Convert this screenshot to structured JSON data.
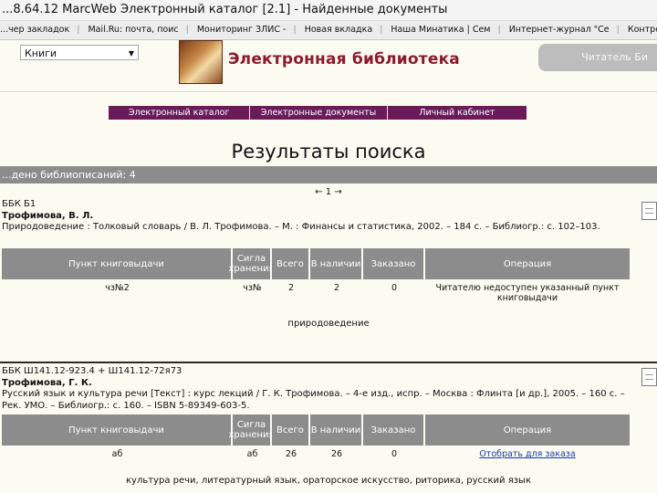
{
  "browser": {
    "window_title": "...8.64.12 MarcWeb Электронный каталог [2.1] - Найденные документы",
    "bookmarks": [
      "...чер закладок",
      "Mail.Ru: почта, поис",
      "Мониторинг ЗЛИС -",
      "Новая вкладка",
      "Наша Минатика | Сем",
      "Интернет-журнал \"Се",
      "Контрольный пост"
    ]
  },
  "header": {
    "search_type": "Книги",
    "library_title": "Электронная библиотека",
    "reader_button": "Читатель Би"
  },
  "nav": [
    "Электронный каталог",
    "Электронные документы",
    "Личный кабинет"
  ],
  "page": {
    "heading": "Результаты поиска",
    "found_text": "...дено библиописаний: 4",
    "pager": "← 1 →"
  },
  "table_headers": [
    "Пункт книговыдачи",
    "Сигла хранения",
    "Всего",
    "В наличии",
    "Заказано",
    "Операция"
  ],
  "records": [
    {
      "line1": "ББК Б1",
      "author": "Трофимова, В. Л.",
      "description": "Природоведение : Толковый словарь / В. Л. Трофимова. – М. : Финансы и статистика, 2002. – 184 с. – Библиогр.: с. 102–103.",
      "row": [
        "чз№2",
        "чз№",
        "2",
        "2",
        "0",
        "Читателю недоступен указанный пункт книговыдачи"
      ],
      "keywords": "природоведение"
    },
    {
      "line1": "ББК Ш141.12-923.4 + Ш141.12-72я73",
      "author": "Трофимова, Г. К.",
      "description": "Русский язык и культура речи [Текст] : курс лекций / Г. К. Трофимова. – 4-е изд., испр. – Москва : Флинта [и др.], 2005. – 160 с. – Рек. УМО. – Библиогр.: с. 160. – ISBN 5-89349-603-5.",
      "row": [
        "аб",
        "аб",
        "26",
        "26",
        "0",
        "Отобрать для заказа"
      ],
      "keywords": "культура речи, литературный язык, ораторское искусство, риторика, русский язык"
    }
  ]
}
